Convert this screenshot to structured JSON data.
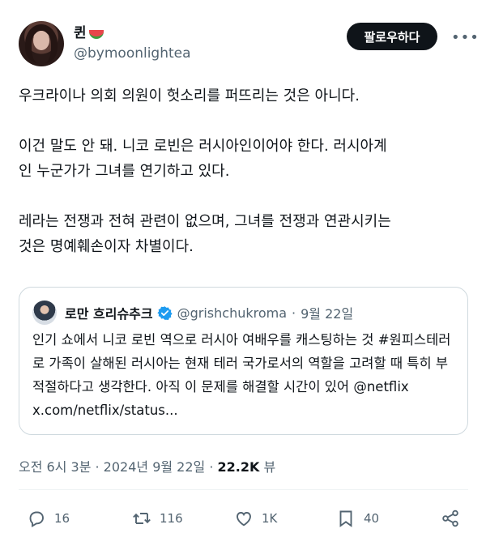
{
  "author": {
    "display_name": "퀸",
    "emoji_icon": "watermelon-icon",
    "handle": "@bymoonlightea"
  },
  "follow_button_label": "팔로우하다",
  "more_icon": "more-options-icon",
  "tweet": {
    "text": "우크라이나 의회 의원이 헛소리를 퍼뜨리는 것은 아니다.\n\n이건 말도 안 돼. 니코 로빈은 러시아인이어야 한다. 러시아계\n인 누군가가 그녀를 연기하고 있다.\n\n레라는 전쟁과 전혀 관련이 없으며, 그녀를 전쟁과 연관시키는\n것은 명예훼손이자 차별이다."
  },
  "quote": {
    "name": "로만 흐리슈추크",
    "verified_icon": "verified-badge-icon",
    "handle": "@grishchukroma",
    "separator": "·",
    "date": "9월 22일",
    "text": "인기 쇼에서 니코 로빈 역으로 러시아 여배우를 캐스팅하는 것 #원피스테러로 가족이 살해된 러시아는 현재 테러 국가로서의 역할을 고려할 때 특히 부적절하다고 생각한다. 아직 이 문제를 해결할 시간이 있어 @netflix x.com/netflix/status..."
  },
  "meta": {
    "time_date": "오전 6시 3분 · 2024년 9월 22일 · ",
    "views_count": "22.2K",
    "views_label": " 뷰"
  },
  "actions": {
    "reply_count": "16",
    "retweet_count": "116",
    "like_count": "1K",
    "bookmark_count": "40"
  },
  "colors": {
    "text_primary": "#0f1419",
    "text_secondary": "#536471",
    "verified_blue": "#1d9bf0",
    "border": "#cfd9de"
  }
}
